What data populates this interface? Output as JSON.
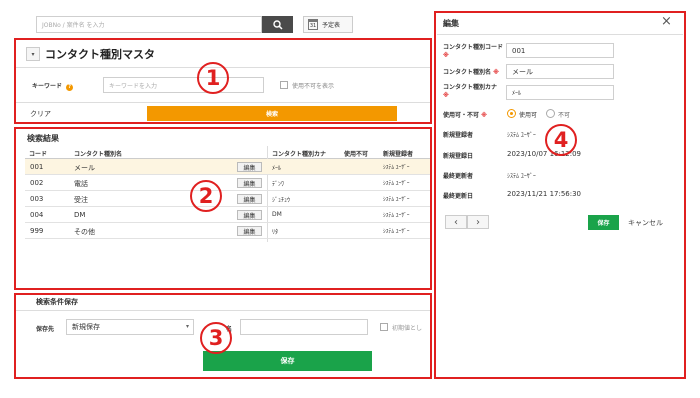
{
  "topbar": {
    "search_placeholder": "JOBNo / 案件名 を入力",
    "schedule_label": "予定表",
    "schedule_day": "31"
  },
  "master": {
    "title": "コンタクト種別マスタ",
    "keyword_label": "キーワード",
    "keyword_placeholder": "キーワードを入力",
    "show_disabled_label": "使用不可を表示",
    "clear_label": "クリア",
    "search_label": "検索"
  },
  "results": {
    "title": "検索結果",
    "columns": [
      "コード",
      "コンタクト種別名",
      "コンタクト種別カナ",
      "使用不可",
      "新規登録者"
    ],
    "edit_label": "編集",
    "rows": [
      {
        "code": "001",
        "name": "メール",
        "kana": "ﾒｰﾙ",
        "registrant": "ｼｽﾃﾑ ﾕｰｻﾞｰ"
      },
      {
        "code": "002",
        "name": "電話",
        "kana": "ﾃﾞﾝﾜ",
        "registrant": "ｼｽﾃﾑ ﾕｰｻﾞｰ"
      },
      {
        "code": "003",
        "name": "受注",
        "kana": "ｼﾞｭﾁｭｳ",
        "registrant": "ｼｽﾃﾑ ﾕｰｻﾞｰ"
      },
      {
        "code": "004",
        "name": "DM",
        "kana": "DM",
        "registrant": "ｼｽﾃﾑ ﾕｰｻﾞｰ"
      },
      {
        "code": "999",
        "name": "その他",
        "kana": "ﾘﾀ",
        "registrant": "ｼｽﾃﾑ ﾕｰｻﾞｰ"
      }
    ]
  },
  "save_conditions": {
    "title": "検索条件保存",
    "save_to_label": "保存先",
    "save_to_value": "新規保存",
    "name_label": "名",
    "default_label": "初期値とし",
    "save_label": "保存"
  },
  "edit_panel": {
    "title": "編集",
    "code_label": "コンタクト種別コード",
    "code_value": "001",
    "name_label": "コンタクト種別名",
    "name_value": "メール",
    "kana_label": "コンタクト種別カナ",
    "kana_value": "ﾒｰﾙ",
    "usable_label": "使用可・不可",
    "usable_option": "使用可",
    "unusable_option": "不可",
    "created_by_label": "新規登録者",
    "created_by_value": "ｼｽﾃﾑ ﾕｰｻﾞｰ",
    "created_at_label": "新規登録日",
    "created_at_value": "2023/10/07 16:12:09",
    "updated_by_label": "最終更新者",
    "updated_by_value": "ｼｽﾃﾑ ﾕｰｻﾞｰ",
    "updated_at_label": "最終更新日",
    "updated_at_value": "2023/11/21 17:56:30",
    "required_mark": "※",
    "save_label": "保存",
    "cancel_label": "キャンセル",
    "close_icon": "×",
    "prev_icon": "‹",
    "next_icon": "›"
  },
  "annotations": [
    "1",
    "2",
    "3",
    "4"
  ],
  "colors": {
    "accent_orange": "#f39800",
    "save_green": "#1aa34a",
    "annotation_red": "#e02020"
  }
}
